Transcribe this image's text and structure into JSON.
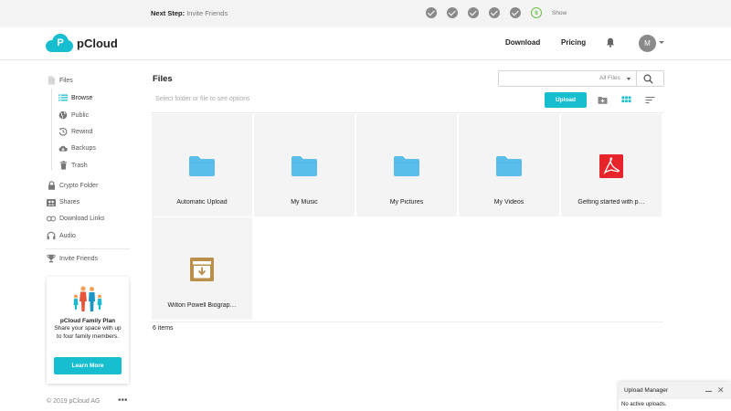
{
  "banner": {
    "next_step_label": "Next Step:",
    "next_step_value": "Invite Friends",
    "current_step_number": "6",
    "show_label": "Show"
  },
  "header": {
    "brand": "pCloud",
    "download_label": "Download",
    "pricing_label": "Pricing",
    "avatar_initial": "M"
  },
  "sidebar": {
    "files": "Files",
    "browse": "Browse",
    "public": "Public",
    "rewind": "Rewind",
    "backups": "Backups",
    "trash": "Trash",
    "crypto_folder": "Crypto Folder",
    "shares": "Shares",
    "download_links": "Download Links",
    "audio": "Audio",
    "invite_friends": "Invite Friends"
  },
  "promo": {
    "title": "pCloud Family Plan",
    "body": "Share your space with up to four family members.",
    "button": "Learn More"
  },
  "footer": {
    "copyright": "© 2019 pCloud AG",
    "more": "•••"
  },
  "main": {
    "title": "Files",
    "search_filter": "All Files",
    "hint": "Select folder or file to see options",
    "upload_label": "Upload",
    "items": [
      {
        "name": "Automatic Upload",
        "type": "folder"
      },
      {
        "name": "My Music",
        "type": "folder"
      },
      {
        "name": "My Pictures",
        "type": "folder"
      },
      {
        "name": "My Videos",
        "type": "folder"
      },
      {
        "name": "Getting started with p…",
        "type": "pdf"
      },
      {
        "name": "Wilton Powell Biograp…",
        "type": "archive"
      }
    ],
    "item_count": "6 items"
  },
  "upload_manager": {
    "title": "Upload Manager",
    "status": "No active uploads."
  },
  "colors": {
    "accent": "#17bed0",
    "folder": "#5bbdea",
    "pdf": "#e8242b",
    "archive": "#b98f4a",
    "step_done": "#8a8a8a",
    "step_current": "#6cc24a"
  }
}
